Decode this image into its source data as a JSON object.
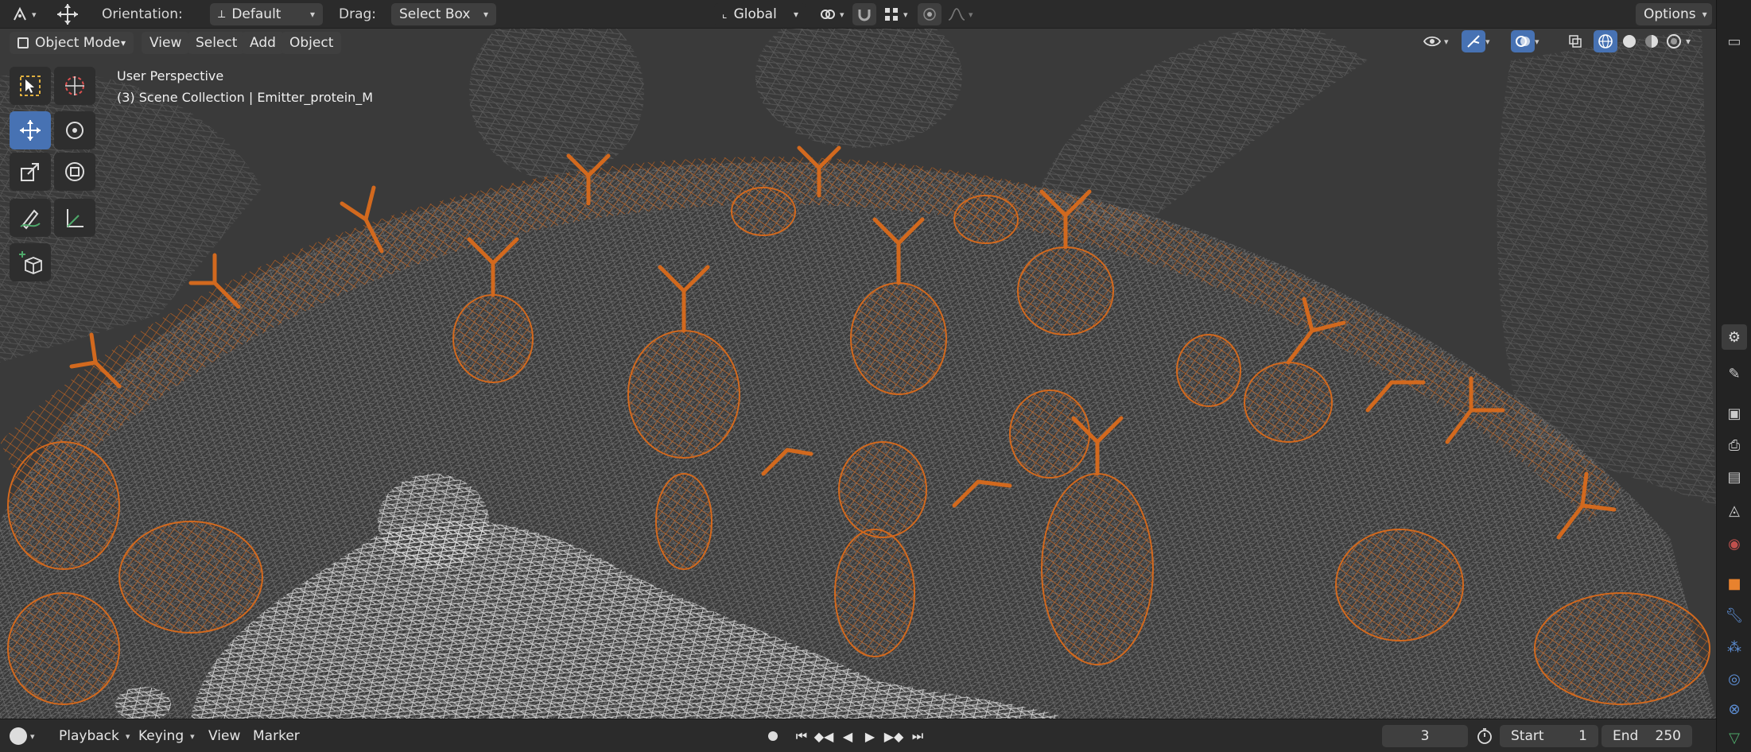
{
  "header": {
    "orientation_label": "Orientation:",
    "orientation_value": "Default",
    "drag_label": "Drag:",
    "drag_value": "Select Box",
    "transform_space": "Global",
    "options_label": "Options"
  },
  "viewport_header": {
    "mode": "Object Mode",
    "menus": [
      "View",
      "Select",
      "Add",
      "Object"
    ]
  },
  "overlay": {
    "perspective": "User Perspective",
    "collection": "(3) Scene Collection | Emitter_protein_M"
  },
  "timeline": {
    "playback_label": "Playback",
    "keying_label": "Keying",
    "view_label": "View",
    "marker_label": "Marker",
    "current_frame": "3",
    "start_label": "Start",
    "start_value": "1",
    "end_label": "End",
    "end_value": "250"
  },
  "colors": {
    "selected_wire": "#d2691e",
    "wire_gray": "#8a8a8a",
    "wire_white": "#d9d9d9",
    "accent": "#4772b3",
    "viewport_bg": "#3a3a3a"
  },
  "icons": {
    "editor_type": "transform-gizmo-icon",
    "move_tool": "move-icon",
    "snap": "magnet-icon",
    "proportional": "proportional-edit-icon"
  }
}
